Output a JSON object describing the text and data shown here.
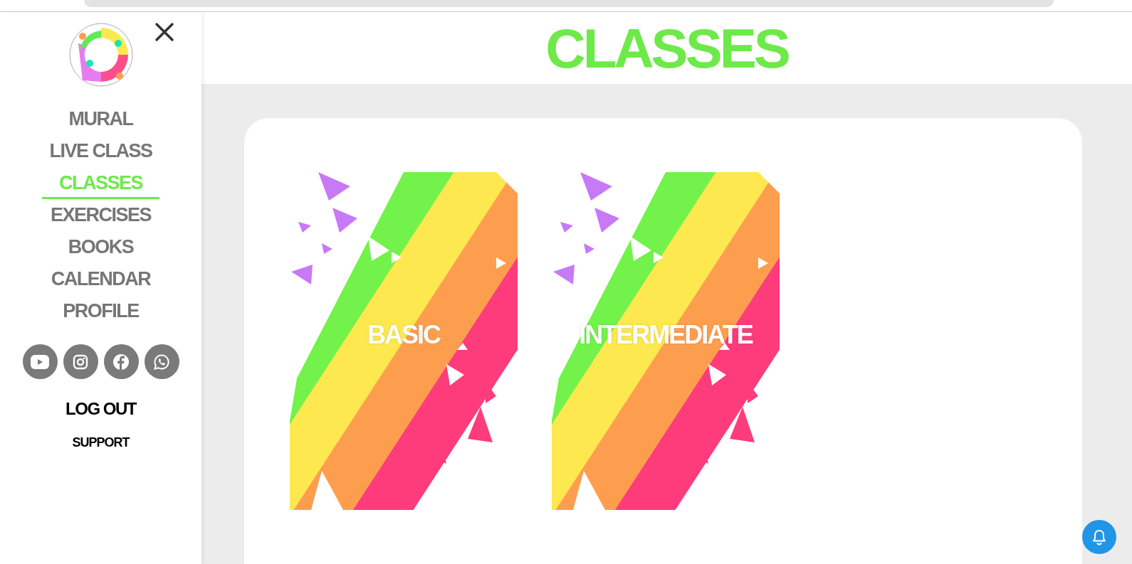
{
  "sidebar": {
    "nav": [
      {
        "label": "MURAL",
        "selected": false
      },
      {
        "label": "LIVE CLASS",
        "selected": false
      },
      {
        "label": "CLASSES",
        "selected": true
      },
      {
        "label": "EXERCISES",
        "selected": false
      },
      {
        "label": "BOOKS",
        "selected": false
      },
      {
        "label": "CALENDAR",
        "selected": false
      },
      {
        "label": "PROFILE",
        "selected": false
      }
    ],
    "logout": "LOG OUT",
    "support": "SUPPORT"
  },
  "page_title": "CLASSES",
  "classes": [
    {
      "name": "BASIC"
    },
    {
      "name": "INTERMEDIATE"
    }
  ]
}
